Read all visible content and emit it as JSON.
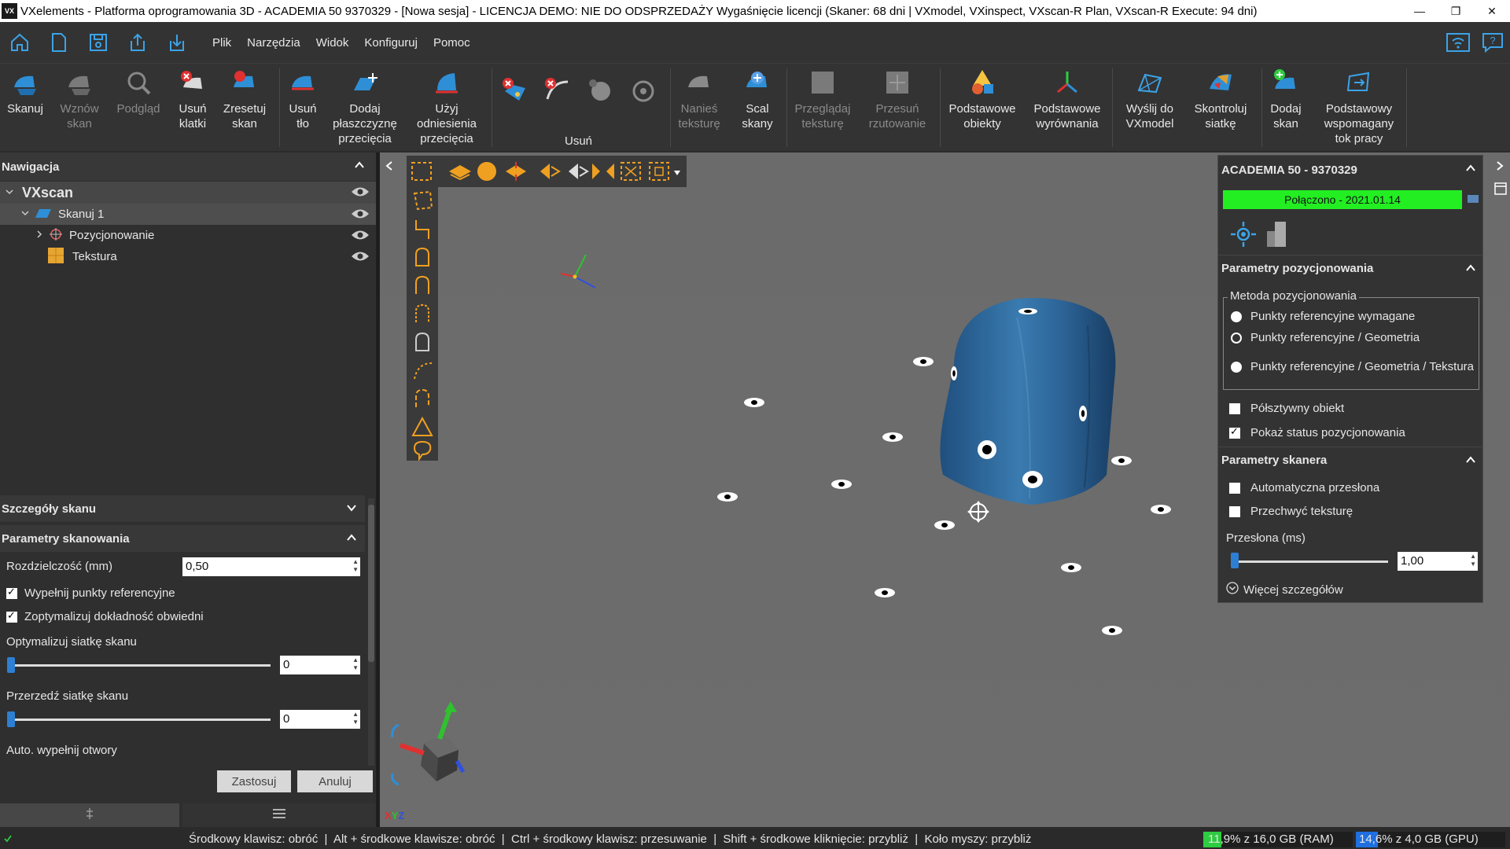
{
  "window": {
    "logo": "VX",
    "title": "VXelements - Platforma oprogramowania 3D - ACADEMIA 50 9370329 - [Nowa sesja] - LICENCJA DEMO: NIE DO ODSPRZEDAŻY Wygaśnięcie licencji (Skaner: 68 dni | VXmodel, VXinspect, VXscan-R Plan, VXscan-R Execute: 94 dni)"
  },
  "menu": [
    "Plik",
    "Narzędzia",
    "Widok",
    "Konfiguruj",
    "Pomoc"
  ],
  "ribbon": {
    "items": [
      {
        "label1": "Skanuj",
        "label2": "",
        "label3": ""
      },
      {
        "label1": "Wznów",
        "label2": "skan",
        "label3": ""
      },
      {
        "label1": "Podgląd",
        "label2": "",
        "label3": ""
      },
      {
        "label1": "Usuń",
        "label2": "klatki",
        "label3": ""
      },
      {
        "label1": "Zresetuj",
        "label2": "skan",
        "label3": ""
      },
      {
        "label1": "Usuń",
        "label2": "tło",
        "label3": ""
      },
      {
        "label1": "Dodaj",
        "label2": "płaszczyznę",
        "label3": "przecięcia"
      },
      {
        "label1": "Użyj",
        "label2": "odniesienia",
        "label3": "przecięcia"
      },
      {
        "label1": "Nanieś",
        "label2": "teksturę",
        "label3": ""
      },
      {
        "label1": "Scal",
        "label2": "skany",
        "label3": ""
      },
      {
        "label1": "Przeglądaj",
        "label2": "teksturę",
        "label3": ""
      },
      {
        "label1": "Przesuń",
        "label2": "rzutowanie",
        "label3": ""
      },
      {
        "label1": "Podstawowe",
        "label2": "obiekty",
        "label3": ""
      },
      {
        "label1": "Podstawowe",
        "label2": "wyrównania",
        "label3": ""
      },
      {
        "label1": "Wyślij do",
        "label2": "VXmodel",
        "label3": ""
      },
      {
        "label1": "Skontroluj",
        "label2": "siatkę",
        "label3": ""
      },
      {
        "label1": "Dodaj",
        "label2": "skan",
        "label3": ""
      },
      {
        "label1": "Podstawowy",
        "label2": "wspomagany",
        "label3": "tok pracy"
      }
    ],
    "group_usun": "Usuń"
  },
  "nav": {
    "title": "Nawigacja",
    "root": "VXscan",
    "scan": "Skanuj 1",
    "child1": "Pozycjonowanie",
    "child2": "Tekstura"
  },
  "details": {
    "title": "Szczegóły skanu",
    "params_title": "Parametry skanowania",
    "resolution_label": "Rozdzielczość (mm)",
    "resolution_value": "0,50",
    "fill_refs": "Wypełnij punkty referencyjne",
    "fill_refs_checked": true,
    "optimize_acc": "Zoptymalizuj dokładność obwiedni",
    "optimize_acc_checked": true,
    "optimize_mesh": "Optymalizuj siatkę skanu",
    "optimize_mesh_value": "0",
    "thin_mesh": "Przerzedź siatkę skanu",
    "thin_mesh_value": "0",
    "auto_fill": "Auto. wypełnij otwory",
    "apply": "Zastosuj",
    "cancel": "Anuluj"
  },
  "device": {
    "title": "ACADEMIA 50 - 9370329",
    "status": "Połączono - 2021.01.14",
    "status_color": "#22ee22"
  },
  "positioning": {
    "title": "Parametry pozycjonowania",
    "method_legend": "Metoda pozycjonowania",
    "opt1": "Punkty referencyjne wymagane",
    "opt2": "Punkty referencyjne / Geometria",
    "opt3": "Punkty referencyjne / Geometria / Tekstura",
    "semi_rigid": "Półsztywny obiekt",
    "show_status": "Pokaż status pozycjonowania"
  },
  "scanner": {
    "title": "Parametry skanera",
    "auto_shutter": "Automatyczna przesłona",
    "capture_texture": "Przechwyć teksturę",
    "shutter_label": "Przesłona (ms)",
    "shutter_value": "1,00",
    "more": "Więcej szczegółów"
  },
  "viewport": {
    "axis_label_x": "X",
    "axis_label_y": "Y",
    "axis_label_z": "Z"
  },
  "status": {
    "hint": "Środkowy klawisz: obróć  |  Alt + środkowe klawisze: obróć  |  Ctrl + środkowy klawisz: przesuwanie  |  Shift + środkowe kliknięcie: przybliż  |  Koło myszy: przybliż",
    "ram": "11,9% z 16,0 GB (RAM)",
    "ram_fraction": 0.119,
    "gpu": "14,6% z 4,0 GB (GPU)",
    "gpu_fraction": 0.146
  }
}
